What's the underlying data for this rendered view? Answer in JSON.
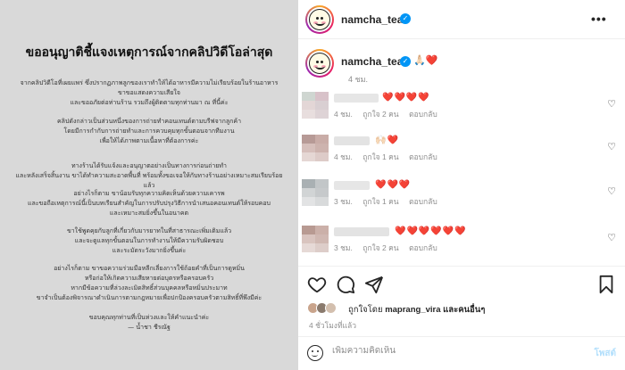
{
  "post_image": {
    "title": "ขออนุญาติชี้แจงเหตุการณ์จากคลิปวิดีโอล่าสุด",
    "paragraphs": [
      [
        "จากคลิปวิดีโอที่เผยแพร่ ซึ่งปรากฏภาพลูกของเราทำให้ได้อาหารมีความไม่เรียบร้อยในร้านอาหาร",
        "ขาขอแสดงความเสียใจ",
        "และขออภัยต่อท่านร้าน รวมถึงผู้ติดตามทุกท่านมา ณ ที่นี้ค่ะ"
      ],
      [
        "คลิปดังกล่าวเป็นส่วนหนึ่งของการถ่ายทำคอนเทนต์ตามบรีฟจากลูกค้า",
        "โดยมีการกำกับการถ่ายทำและการควบคุมทุกขั้นตอนจากทีมงาน",
        "เพื่อให้ได้ภาพตามเนื้อหาที่ต้องการค่ะ"
      ],
      [
        "ทางร้านได้รับแจ้งและอนุญาตอย่างเป็นทางการก่อนถ่ายทำ",
        "และหลังเสร็จสิ้นงาน ขาได้ทำความสะอาดพื้นที่ พร้อมทั้งขอเจอให้กับทางร้านอย่างเหมาะสมเรียบร้อยแล้ว"
      ],
      [
        "อย่างไรก็ตาม ขาน้อมรับทุกความคิดเห็นด้วยความเคารพ",
        "และขอถือเหตุการณ์นี้เป็นบทเรียนสำคัญในการปรับปรุงวิธีการนำเสนอคอนเทนต์ให้รอบคอบ",
        "และเหมาะสมยิ่งขึ้นในอนาคต"
      ],
      [
        "ขาใช้พูดคุยกับลูกที่เกี่ยวกับมารยาทในที่สาธารณะเพิ่มเติมแล้ว",
        "และจะดูแลทุกขั้นตอนในการทำงานให้มีความรับผิดชอบ",
        "และระมัดระวังมากยิ่งขึ้นค่ะ"
      ],
      [
        "อย่างไรก็ตาม ขาขอความร่วมมือหลีกเลี่ยงการใช้ถ้อยคำที่เป็นการดูหมิ่น",
        "หรือก่อให้เกิดความเสียหายต่อบุตรหรือครอบครัว",
        "หากมีข้อความที่ล่วงละเมิดสิทธิ์ส่วนบุคคลหรือหมิ่นประมาท",
        "ขาจำเป็นต้องพิจารณาดำเนินการตามกฎหมายเพื่อปกป้องครอบครัวตามสิทธิ์ที่พึงมีค่ะ"
      ],
      [
        "ขอบคุณทุกท่านที่เป็นห่วงและให้คำแนะนำค่ะ",
        "— น้ำชา ชีรณัฐ"
      ]
    ]
  },
  "header": {
    "username": "namcha_tea",
    "verified_symbol": "✓",
    "more_symbol": "•••"
  },
  "caption": {
    "username": "namcha_tea",
    "emoji": "🙏🏻❤️",
    "time": "4 ชม."
  },
  "comments": [
    {
      "text": "❤️❤️❤️❤️",
      "time": "4 ชม.",
      "likes": "ถูกใจ 2 คน",
      "reply": "ตอบกลับ"
    },
    {
      "text": "🙌🏻❤️",
      "time": "4 ชม.",
      "likes": "ถูกใจ 1 คน",
      "reply": "ตอบกลับ"
    },
    {
      "text": "❤️❤️❤️",
      "time": "3 ชม.",
      "likes": "ถูกใจ 1 คน",
      "reply": "ตอบกลับ"
    },
    {
      "text": "❤️❤️❤️❤️❤️❤️",
      "time": "3 ชม.",
      "likes": "ถูกใจ 2 คน",
      "reply": "ตอบกลับ"
    }
  ],
  "actions": {
    "icons": [
      "heart-icon",
      "comment-icon",
      "share-icon",
      "bookmark-icon"
    ]
  },
  "likes": {
    "prefix": "ถูกใจโดย",
    "user": "maprang_vira",
    "suffix": "และคนอื่นๆ"
  },
  "post_time": "4 ชั่วโมงที่แล้ว",
  "comment_bar": {
    "placeholder": "เพิ่มความคิดเห็น",
    "post_label": "โพสต์"
  },
  "colors": {
    "accent": "#0095f6",
    "like_red": "#e0245e",
    "muted": "#8e8e8e"
  }
}
